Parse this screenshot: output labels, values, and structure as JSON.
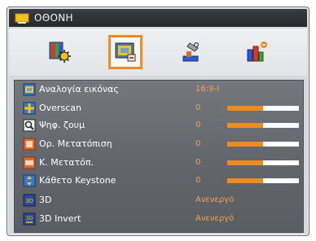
{
  "window": {
    "title": "ΟΘΟΝΗ"
  },
  "tabs": [
    {
      "icon": "picture-settings-icon",
      "active": false
    },
    {
      "icon": "display-screen-icon",
      "active": true
    },
    {
      "icon": "setup-tools-icon",
      "active": false
    },
    {
      "icon": "options-icon",
      "active": false
    }
  ],
  "rows": [
    {
      "label": "Αναλογία εικόνας",
      "value": "16:9-I",
      "icon": "aspect-ratio-icon"
    },
    {
      "label": "Overscan",
      "value": "0",
      "level": 0.5,
      "icon": "overscan-icon"
    },
    {
      "label": "Ψηφ. ζουμ",
      "value": "0",
      "level": 0.5,
      "icon": "digital-zoom-icon"
    },
    {
      "label": "Ορ. Μετατόπιση",
      "value": "0",
      "level": 0.5,
      "icon": "h-shift-icon"
    },
    {
      "label": "Κ. Μετατόπ.",
      "value": "0",
      "level": 0.5,
      "icon": "v-shift-icon"
    },
    {
      "label": "Κάθετο Keystone",
      "value": "0",
      "level": 0.5,
      "icon": "v-keystone-icon"
    },
    {
      "label": "3D",
      "value": "Ανενεργό",
      "icon": "3d-icon"
    },
    {
      "label": "3D Invert",
      "value": "Ανενεργό",
      "icon": "3d-invert-icon"
    }
  ],
  "colors": {
    "accent": "#f08c1e",
    "value_text": "#f0a24a"
  }
}
